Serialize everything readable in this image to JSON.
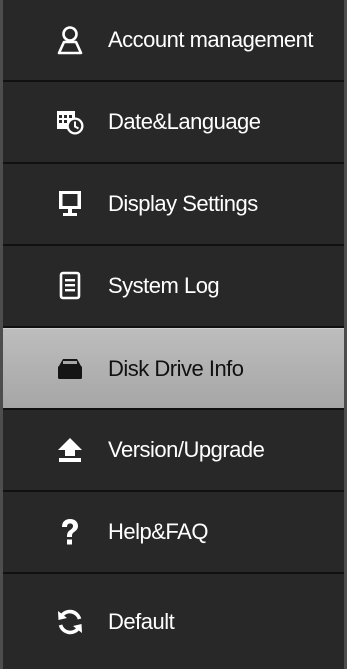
{
  "menu": {
    "items": [
      {
        "label": "Account management",
        "icon": "user-icon"
      },
      {
        "label": "Date&Language",
        "icon": "calendar-clock-icon"
      },
      {
        "label": "Display Settings",
        "icon": "monitor-icon"
      },
      {
        "label": "System Log",
        "icon": "document-icon"
      },
      {
        "label": "Disk Drive Info",
        "icon": "disk-drive-icon",
        "selected": true
      },
      {
        "label": "Version/Upgrade",
        "icon": "upload-arrow-icon"
      },
      {
        "label": "Help&FAQ",
        "icon": "question-icon"
      },
      {
        "label": "Default",
        "icon": "refresh-icon"
      }
    ]
  },
  "colors": {
    "background": "#282828",
    "selected_background": "#b0b0b0",
    "text": "#ffffff",
    "selected_text": "#111111"
  }
}
